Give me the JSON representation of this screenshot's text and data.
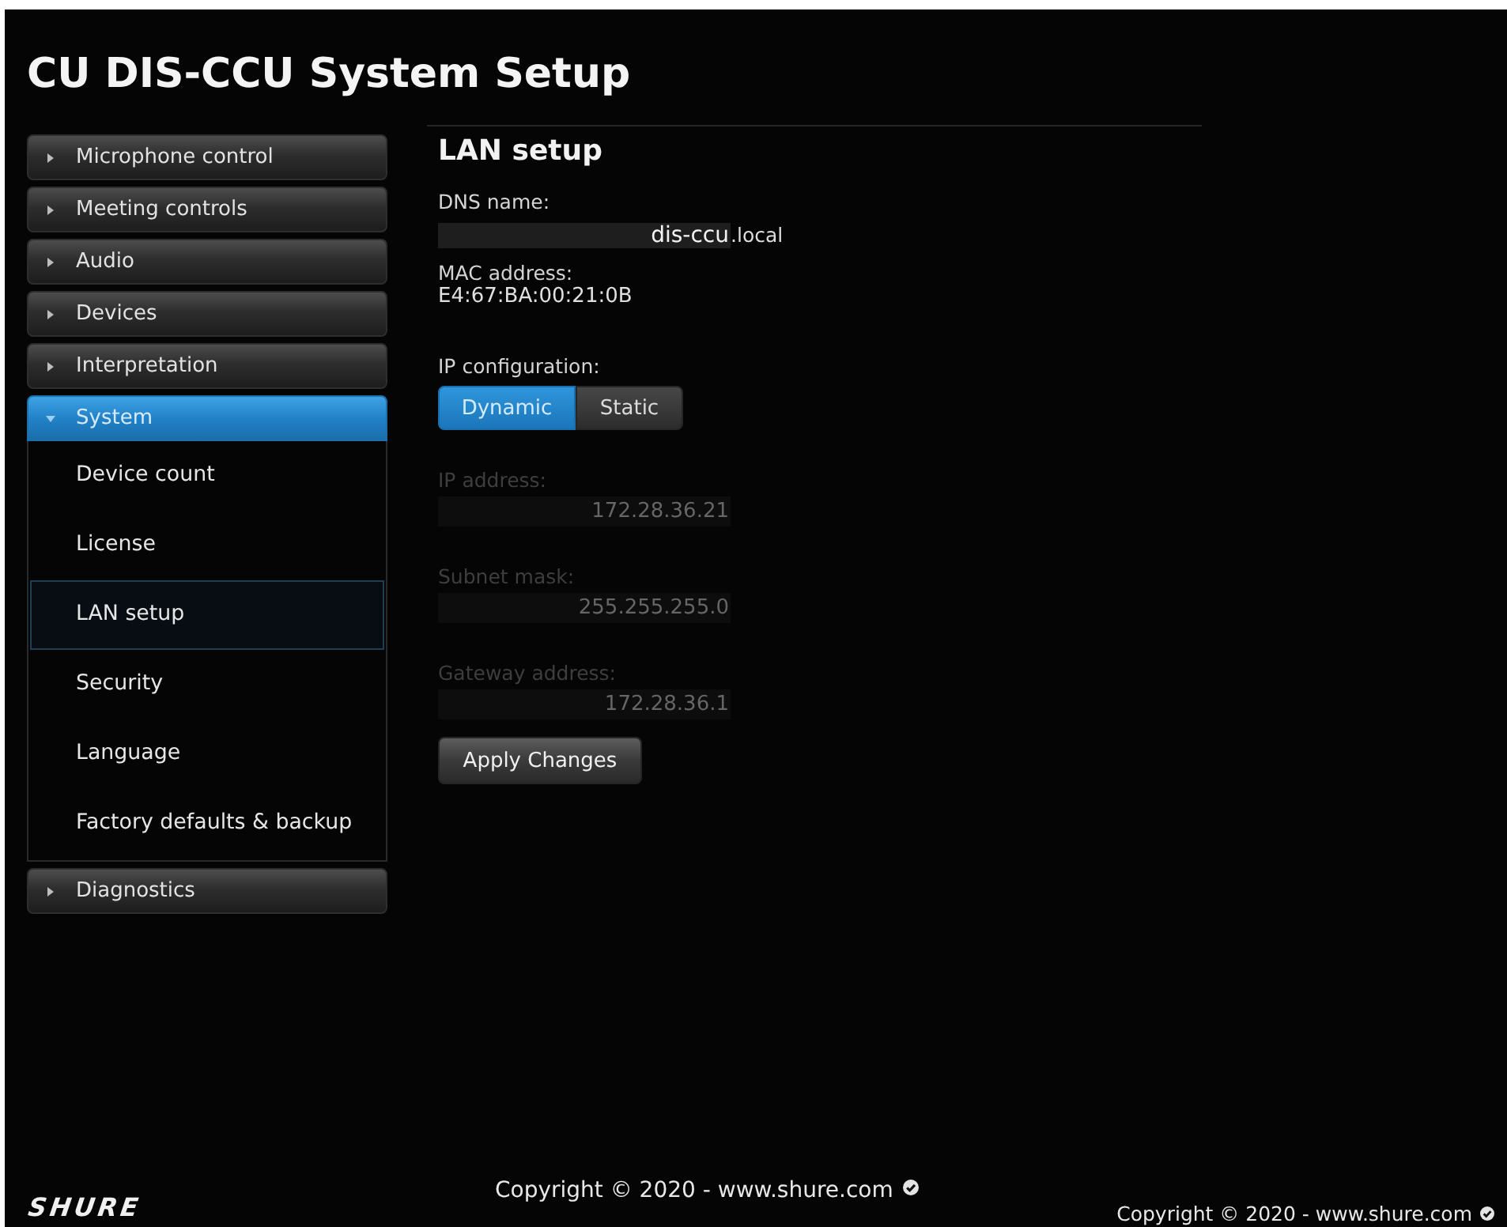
{
  "page": {
    "title": "CU DIS-CCU System Setup"
  },
  "sidebar": {
    "items": [
      {
        "label": "Microphone control",
        "expanded": false
      },
      {
        "label": "Meeting controls",
        "expanded": false
      },
      {
        "label": "Audio",
        "expanded": false
      },
      {
        "label": "Devices",
        "expanded": false
      },
      {
        "label": "Interpretation",
        "expanded": false
      },
      {
        "label": "System",
        "expanded": true,
        "children": [
          {
            "label": "Device count",
            "selected": false
          },
          {
            "label": "License",
            "selected": false
          },
          {
            "label": "LAN setup",
            "selected": true
          },
          {
            "label": "Security",
            "selected": false
          },
          {
            "label": "Language",
            "selected": false
          },
          {
            "label": "Factory defaults & backup",
            "selected": false
          }
        ]
      },
      {
        "label": "Diagnostics",
        "expanded": false
      }
    ]
  },
  "content": {
    "heading": "LAN setup",
    "fields": [
      {
        "kind": "input",
        "label": "DNS name:",
        "value": "dis-ccu",
        "suffix": ".local",
        "disabled": false
      },
      {
        "kind": "text",
        "label": "MAC address:",
        "value": "E4:67:BA:00:21:0B"
      },
      {
        "kind": "segmented",
        "label": "IP configuration:",
        "options": [
          {
            "label": "Dynamic",
            "selected": true
          },
          {
            "label": "Static",
            "selected": false
          }
        ]
      },
      {
        "kind": "input",
        "label": "IP address:",
        "value": "172.28.36.21",
        "disabled": true
      },
      {
        "kind": "input",
        "label": "Subnet mask:",
        "value": "255.255.255.0",
        "disabled": true
      },
      {
        "kind": "input",
        "label": "Gateway address:",
        "value": "172.28.36.1",
        "disabled": true
      }
    ],
    "apply_button": "Apply Changes"
  },
  "footer": {
    "logo": "SHURE",
    "copyright": "Copyright © 2020 - www.shure.com",
    "copyright_right": "Copyright © 2020 - www.shure.com"
  }
}
